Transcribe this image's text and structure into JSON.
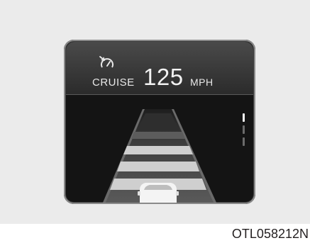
{
  "figure": {
    "code": "OTL058212N"
  },
  "cluster": {
    "mode_label": "CRUISE",
    "set_speed": "125",
    "speed_unit": "MPH",
    "icon": "speedometer-arrow-icon",
    "distance_levels_total": 4,
    "distance_level_active": 1,
    "vehicle_ahead_shown": false
  },
  "colors": {
    "screen": "#141414",
    "header": "#3a3a3a",
    "text": "#f2f2f2",
    "road": "#4d4d4d",
    "lane_bar": "#cfcfcf",
    "car": "#ffffff"
  }
}
